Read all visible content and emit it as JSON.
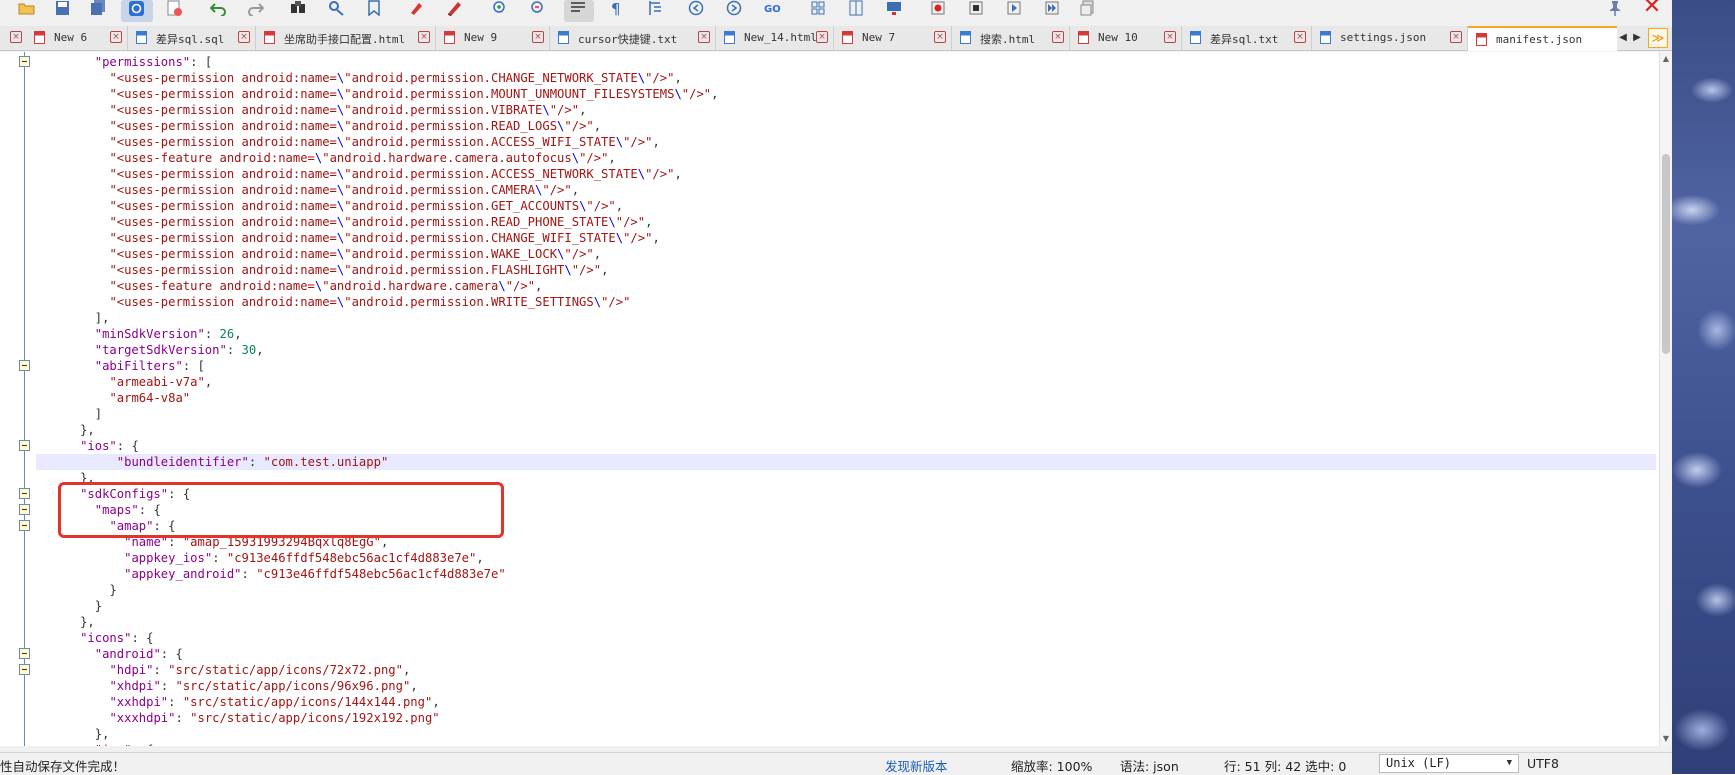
{
  "tabs": [
    {
      "label": "New 6",
      "icon_color": "#d43a3a",
      "active": false
    },
    {
      "label": "差异sql.sql",
      "icon_color": "#3a7bd4",
      "active": false
    },
    {
      "label": "坐席助手接口配置.html",
      "icon_color": "#d43a3a",
      "active": false
    },
    {
      "label": "New 9",
      "icon_color": "#d43a3a",
      "active": false
    },
    {
      "label": "cursor快捷键.txt",
      "icon_color": "#3a7bd4",
      "active": false
    },
    {
      "label": "New_14.html",
      "icon_color": "#3a7bd4",
      "active": false
    },
    {
      "label": "New 7",
      "icon_color": "#d43a3a",
      "active": false
    },
    {
      "label": "搜索.html",
      "icon_color": "#3a7bd4",
      "active": false
    },
    {
      "label": "New 10",
      "icon_color": "#d43a3a",
      "active": false
    },
    {
      "label": "差异sql.txt",
      "icon_color": "#3a7bd4",
      "active": false
    },
    {
      "label": "settings.json",
      "icon_color": "#3a7bd4",
      "active": false
    },
    {
      "label": "manifest.json",
      "icon_color": "#d43a3a",
      "active": true
    }
  ],
  "code_lines": [
    "        \"permissions\": [",
    "          \"<uses-permission android:name=\\\"android.permission.CHANGE_NETWORK_STATE\\\"/>\",",
    "          \"<uses-permission android:name=\\\"android.permission.MOUNT_UNMOUNT_FILESYSTEMS\\\"/>\",",
    "          \"<uses-permission android:name=\\\"android.permission.VIBRATE\\\"/>\",",
    "          \"<uses-permission android:name=\\\"android.permission.READ_LOGS\\\"/>\",",
    "          \"<uses-permission android:name=\\\"android.permission.ACCESS_WIFI_STATE\\\"/>\",",
    "          \"<uses-feature android:name=\\\"android.hardware.camera.autofocus\\\"/>\",",
    "          \"<uses-permission android:name=\\\"android.permission.ACCESS_NETWORK_STATE\\\"/>\",",
    "          \"<uses-permission android:name=\\\"android.permission.CAMERA\\\"/>\",",
    "          \"<uses-permission android:name=\\\"android.permission.GET_ACCOUNTS\\\"/>\",",
    "          \"<uses-permission android:name=\\\"android.permission.READ_PHONE_STATE\\\"/>\",",
    "          \"<uses-permission android:name=\\\"android.permission.CHANGE_WIFI_STATE\\\"/>\",",
    "          \"<uses-permission android:name=\\\"android.permission.WAKE_LOCK\\\"/>\",",
    "          \"<uses-permission android:name=\\\"android.permission.FLASHLIGHT\\\"/>\",",
    "          \"<uses-feature android:name=\\\"android.hardware.camera\\\"/>\",",
    "          \"<uses-permission android:name=\\\"android.permission.WRITE_SETTINGS\\\"/>\"",
    "        ],",
    "        \"minSdkVersion\": 26,",
    "        \"targetSdkVersion\": 30,",
    "        \"abiFilters\": [",
    "          \"armeabi-v7a\",",
    "          \"arm64-v8a\"",
    "        ]",
    "      },",
    "      \"ios\": {",
    "           \"bundleidentifier\": \"com.test.uniapp\"",
    "      },",
    "      \"sdkConfigs\": {",
    "        \"maps\": {",
    "          \"amap\": {",
    "            \"name\": \"amap_15931993294Bqxlq8EgG\",",
    "            \"appkey_ios\": \"c913e46ffdf548ebc56ac1cf4d883e7e\",",
    "            \"appkey_android\": \"c913e46ffdf548ebc56ac1cf4d883e7e\"",
    "          }",
    "        }",
    "      },",
    "      \"icons\": {",
    "        \"android\": {",
    "          \"hdpi\": \"src/static/app/icons/72x72.png\",",
    "          \"xhdpi\": \"src/static/app/icons/96x96.png\",",
    "          \"xxhdpi\": \"src/static/app/icons/144x144.png\",",
    "          \"xxxhdpi\": \"src/static/app/icons/192x192.png\"",
    "        },",
    "        \"ios\": {"
  ],
  "current_line_index": 25,
  "status": {
    "message": "性自动保存文件完成！",
    "new_version": "发现新版本",
    "zoom": "缩放率: 100%",
    "syntax": "语法: json",
    "position": "行: 51 列: 42 选中: 0",
    "eol": "Unix (LF)",
    "encoding": "UTF8"
  }
}
